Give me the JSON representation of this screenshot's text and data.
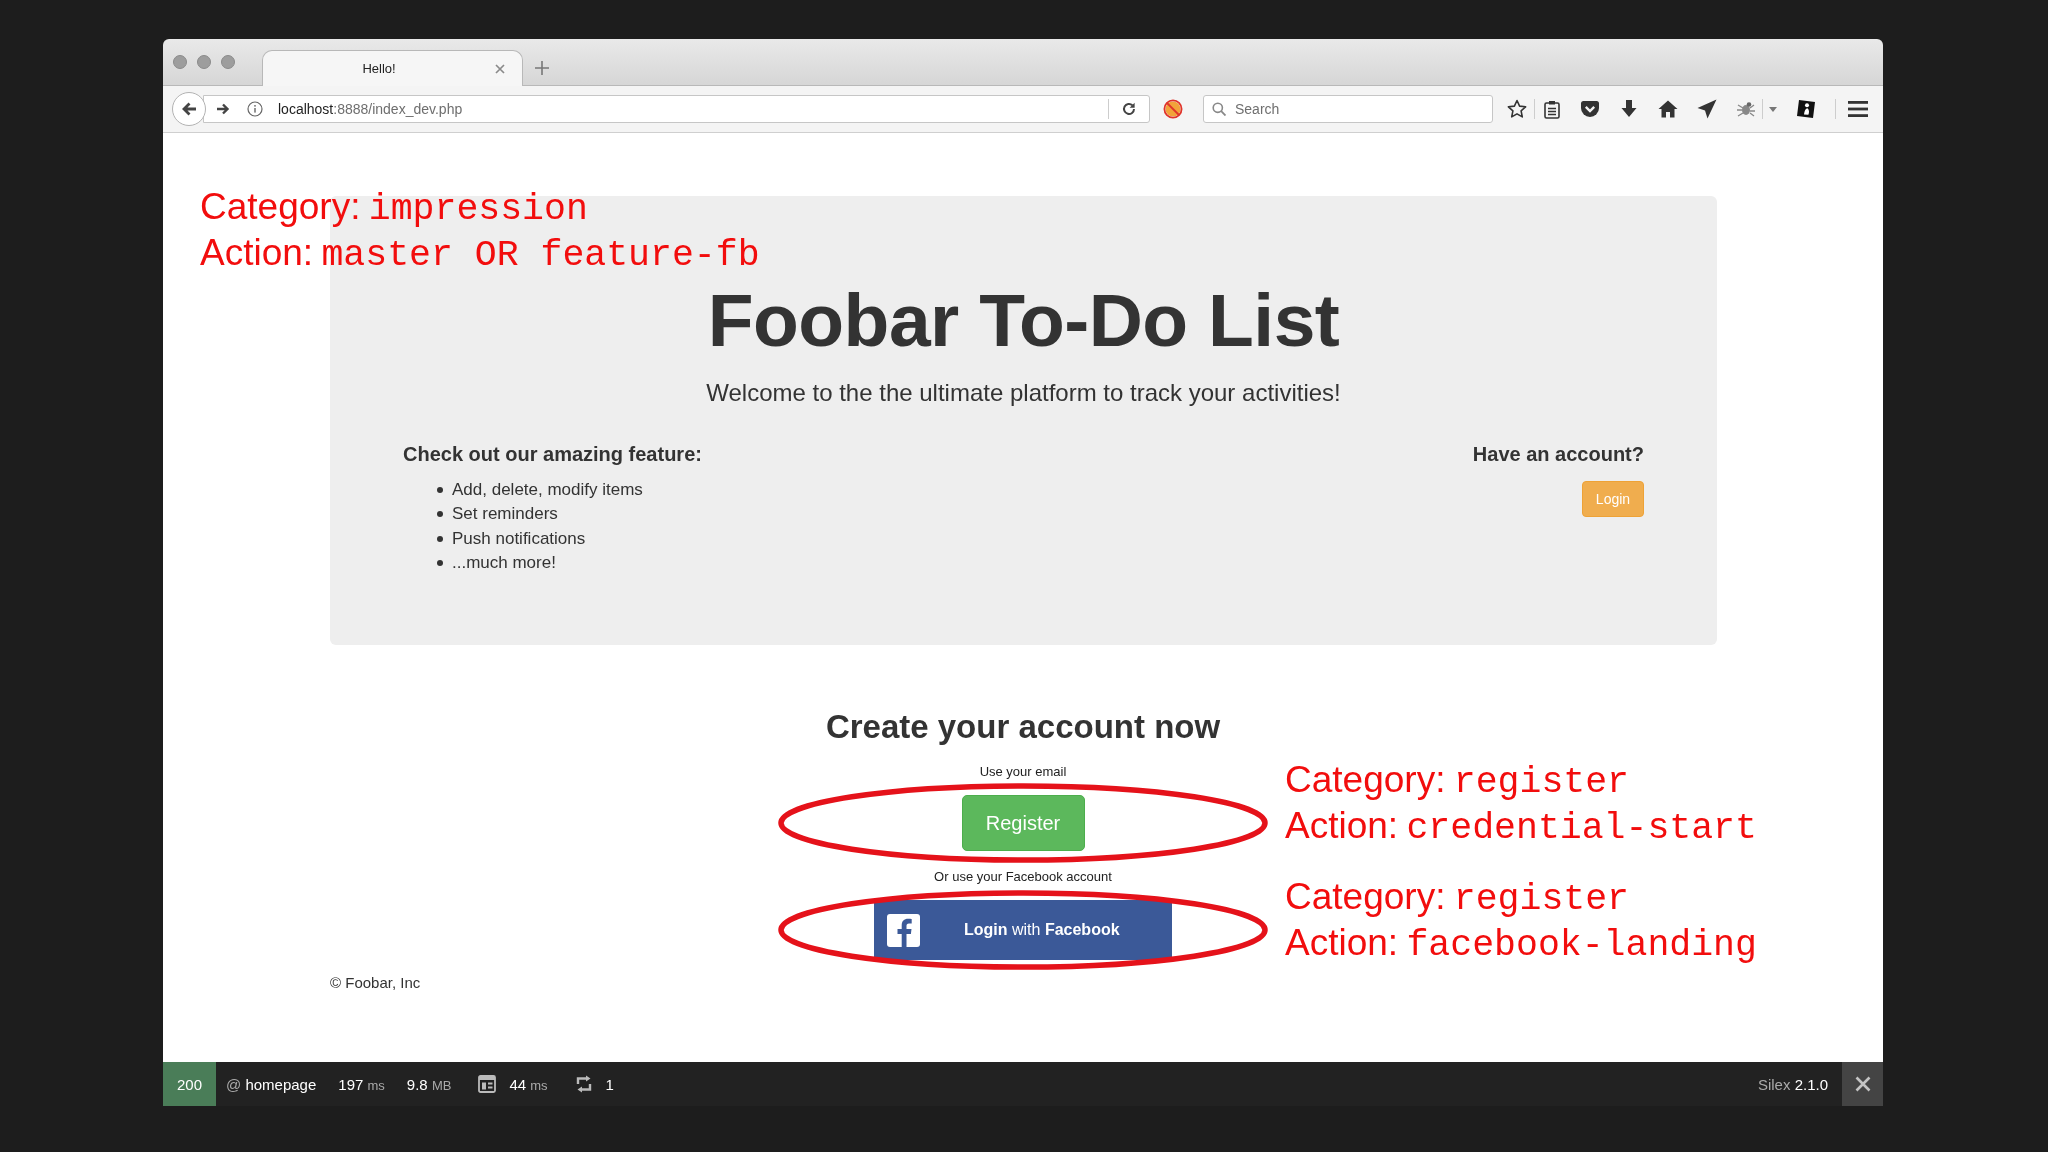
{
  "browser": {
    "tab_title": "Hello!",
    "address": {
      "host": "localhost",
      "path": ":8888/index_dev.php"
    },
    "search": {
      "placeholder": "Search"
    }
  },
  "page": {
    "jumbotron": {
      "annotation": [
        {
          "label": "Category:",
          "value": "impression"
        },
        {
          "label": "Action:",
          "value": "master OR feature-fb"
        }
      ],
      "title": "Foobar To-Do List",
      "subtitle": "Welcome to the the ultimate platform to track your activities!",
      "features": {
        "heading": "Check out our amazing feature:",
        "items": [
          "Add, delete, modify items",
          "Set reminders",
          "Push notifications",
          "...much more!"
        ]
      },
      "account": {
        "heading": "Have an account?",
        "button": "Login"
      }
    },
    "signup": {
      "heading": "Create your account now",
      "options": [
        {
          "kind": "email",
          "hint": "Use your email",
          "button": "Register",
          "highlighted": true,
          "annotation": [
            {
              "label": "Category:",
              "value": "register"
            },
            {
              "label": "Action:",
              "value": "credential-start"
            }
          ]
        },
        {
          "kind": "facebook",
          "hint": "Or use your Facebook account",
          "button": "**Login** with **Facebook**",
          "highlighted": true,
          "annotation": [
            {
              "label": "Category:",
              "value": "register"
            },
            {
              "label": "Action:",
              "value": "facebook-landing"
            }
          ]
        }
      ]
    },
    "footer": "© Foobar, Inc"
  },
  "debug_toolbar": {
    "status": "200",
    "route": {
      "prefix": "@",
      "name": "homepage"
    },
    "metrics": [
      {
        "kind": "plain",
        "value": "197",
        "unit": "ms"
      },
      {
        "kind": "plain",
        "value": "9.8",
        "unit": "MB"
      },
      {
        "kind": "layout",
        "value": "44",
        "unit": "ms"
      },
      {
        "kind": "sync",
        "value": "1"
      }
    ],
    "framework": {
      "name": "Silex",
      "version": "2.1.0"
    }
  }
}
